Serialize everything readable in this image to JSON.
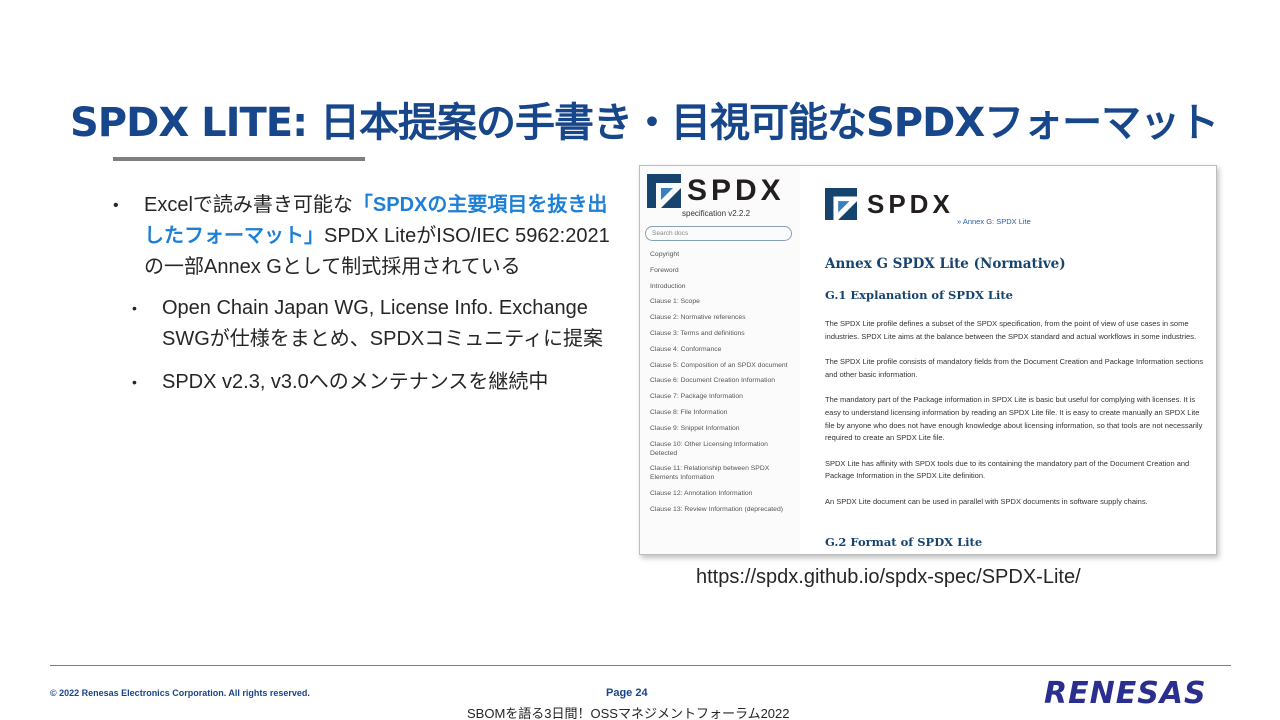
{
  "slide": {
    "title": "SPDX LITE: 日本提案の手書き・目視可能なSPDXフォーマット"
  },
  "bullets": {
    "main_pre": "Excelで読み書き可能な",
    "main_highlight": "「SPDXの主要項目を抜き出したフォーマット」",
    "main_post": "SPDX LiteがISO/IEC 5962:2021の一部Annex Gとして制式採用されている",
    "sub": [
      "Open Chain Japan WG, License Info. Exchange SWGが仕様をまとめ、SPDXコミュニティに提案",
      "SPDX v2.3, v3.0へのメンテナンスを継続中"
    ]
  },
  "screenshot": {
    "sidebar": {
      "logo_text": "SPDX",
      "version": "specification v2.2.2",
      "search_placeholder": "Search docs",
      "toc": [
        "Copyright",
        "Foreword",
        "Introduction",
        "Clause 1: Scope",
        "Clause 2: Normative references",
        "Clause 3: Terms and definitions",
        "Clause 4: Conformance",
        "Clause 5: Composition of an SPDX document",
        "Clause 6: Document Creation Information",
        "Clause 7: Package Information",
        "Clause 8: File Information",
        "Clause 9: Snippet Information",
        "Clause 10: Other Licensing Information Detected",
        "Clause 11: Relationship between SPDX Elements Information",
        "Clause 12: Annotation Information",
        "Clause 13: Review Information (deprecated)"
      ]
    },
    "main": {
      "logo_text": "SPDX",
      "breadcrumb": "» Annex G: SPDX Lite",
      "heading": "Annex G SPDX Lite (Normative)",
      "section1": "G.1 Explanation of SPDX Lite",
      "paragraphs": [
        "The SPDX Lite profile defines a subset of the SPDX specification, from the point of view of use cases in some industries. SPDX Lite aims at the balance between the SPDX standard and actual workflows in some industries.",
        "The SPDX Lite profile consists of mandatory fields from the Document Creation and Package Information sections and other basic information.",
        "The mandatory part of the Package information in SPDX Lite is basic but useful for complying with licenses. It is easy to understand licensing information by reading an SPDX Lite file. It is easy to create manually an SPDX Lite file by anyone who does not have enough knowledge about licensing information, so that tools are not necessarily required to create an SPDX Lite file.",
        "SPDX Lite has affinity with SPDX tools due to its containing the mandatory part of the Document Creation and Package Information in the SPDX Lite definition.",
        "An SPDX Lite document can be used in parallel with SPDX documents in software supply chains."
      ],
      "section2": "G.2 Format of SPDX Lite"
    },
    "url": "https://spdx.github.io/spdx-spec/SPDX-Lite/"
  },
  "footer": {
    "copyright": "© 2022 Renesas Electronics Corporation. All rights reserved.",
    "page": "Page 24",
    "event": "SBOMを語る3日間！OSSマネジメントフォーラム2022",
    "brand": "RENESAS",
    "brand_color": "#2a2f8f"
  },
  "colors": {
    "title": "#17468a",
    "highlight": "#1e7fd6",
    "spdx_logo": "#17446f"
  }
}
